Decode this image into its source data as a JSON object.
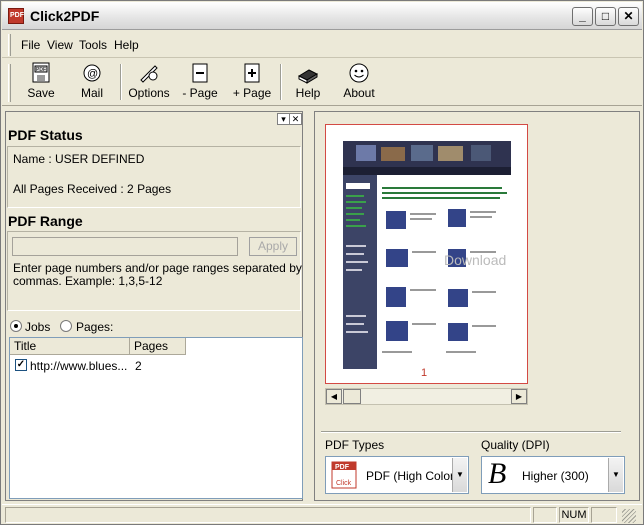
{
  "window": {
    "title": "Click2PDF",
    "minimize": "_",
    "maximize": "□",
    "close": "✕"
  },
  "menu": [
    "File",
    "View",
    "Tools",
    "Help"
  ],
  "toolbar": {
    "save": "Save",
    "mail": "Mail",
    "options": "Options",
    "remove_page": "- Page",
    "add_page": "+ Page",
    "help": "Help",
    "about": "About"
  },
  "left_pane": {
    "pin": "▾",
    "close": "✕",
    "pdf_status": {
      "title": "PDF Status",
      "name": "Name : USER DEFINED",
      "pages": "All Pages Received : 2 Pages"
    },
    "pdf_range": {
      "title": "PDF Range",
      "input_value": "",
      "apply": "Apply",
      "hint_line1": "Enter page numbers and/or page ranges separated by",
      "hint_line2": "commas.  Example:  1,3,5-12"
    },
    "view_mode": {
      "jobs": "Jobs",
      "pages": "Pages:"
    },
    "jobs_list": {
      "columns": [
        "Title",
        "Pages"
      ],
      "rows": [
        {
          "checked": true,
          "title": "http://www.blues...",
          "pages": "2"
        }
      ]
    }
  },
  "preview": {
    "page_number": "1",
    "watermark": "Download"
  },
  "pdf_types": {
    "label": "PDF Types",
    "selected": "PDF (High Color) F"
  },
  "quality": {
    "label": "Quality (DPI)",
    "selected": "Higher (300)"
  },
  "status_bar": {
    "num": "NUM"
  },
  "colors": {
    "accent": "#d34a44",
    "preview_dark": "#2f3350"
  }
}
